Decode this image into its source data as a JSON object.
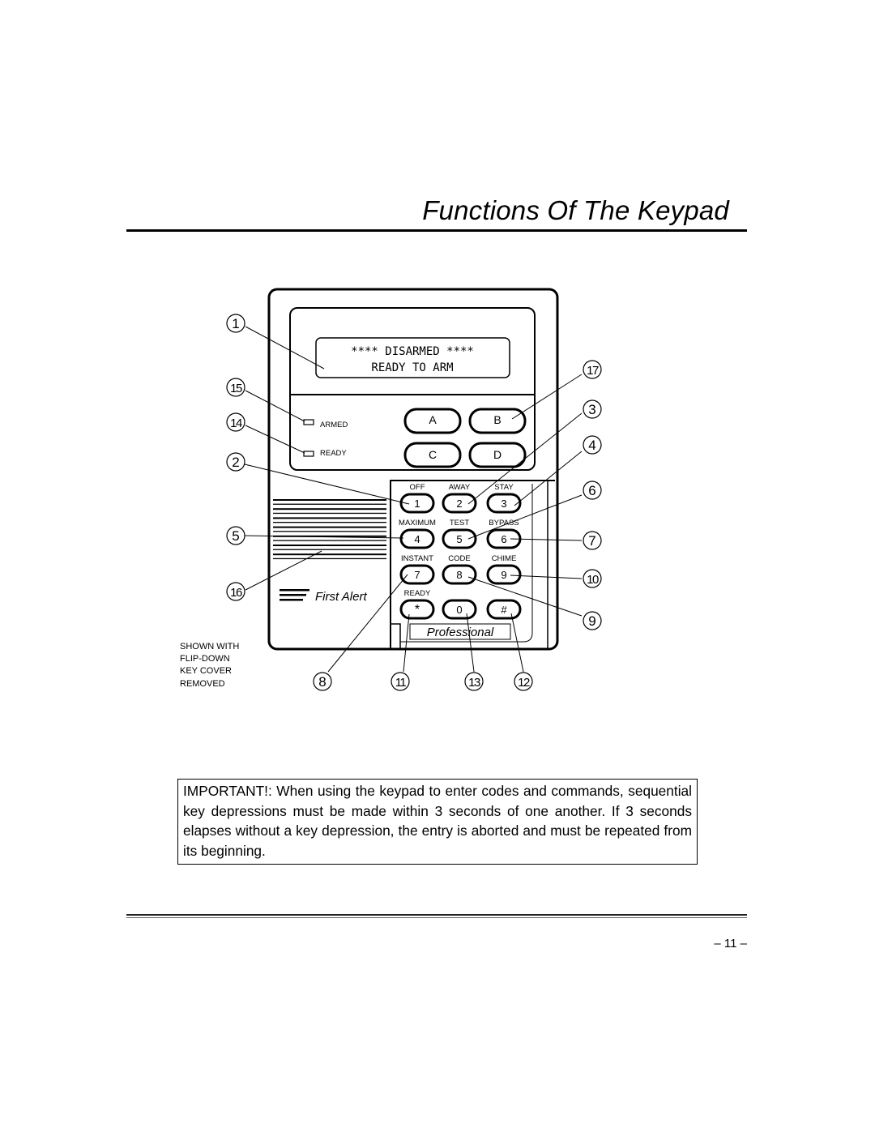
{
  "page": {
    "title": "Functions Of The Keypad",
    "page_number": "– 11 –"
  },
  "keypad": {
    "display": {
      "line1": "**** DISARMED ****",
      "line2": "READY TO ARM"
    },
    "indicators": [
      {
        "label": "ARMED"
      },
      {
        "label": "READY"
      }
    ],
    "function_keys": [
      "A",
      "B",
      "C",
      "D"
    ],
    "keys": [
      {
        "label": "1",
        "caption": "OFF"
      },
      {
        "label": "2",
        "caption": "AWAY"
      },
      {
        "label": "3",
        "caption": "STAY"
      },
      {
        "label": "4",
        "caption": "MAXIMUM"
      },
      {
        "label": "5",
        "caption": "TEST"
      },
      {
        "label": "6",
        "caption": "BYPASS"
      },
      {
        "label": "7",
        "caption": "INSTANT"
      },
      {
        "label": "8",
        "caption": "CODE"
      },
      {
        "label": "9",
        "caption": "CHIME"
      },
      {
        "label": "*",
        "caption": "READY"
      },
      {
        "label": "0",
        "caption": ""
      },
      {
        "label": "#",
        "caption": ""
      }
    ],
    "brand": "First Alert",
    "model_label": "Professional"
  },
  "callouts": [
    "1",
    "15",
    "14",
    "2",
    "5",
    "16",
    "17",
    "3",
    "4",
    "6",
    "7",
    "10",
    "9",
    "8",
    "11",
    "13",
    "12"
  ],
  "note": {
    "lines": [
      "SHOWN WITH",
      "FLIP-DOWN",
      "KEY COVER",
      "REMOVED"
    ]
  },
  "important_text": "IMPORTANT!: When using the keypad to enter codes and commands, sequential key depressions must be made within 3 seconds of one another. If 3 seconds elapses without a key depression, the entry is aborted and must be repeated from its beginning."
}
